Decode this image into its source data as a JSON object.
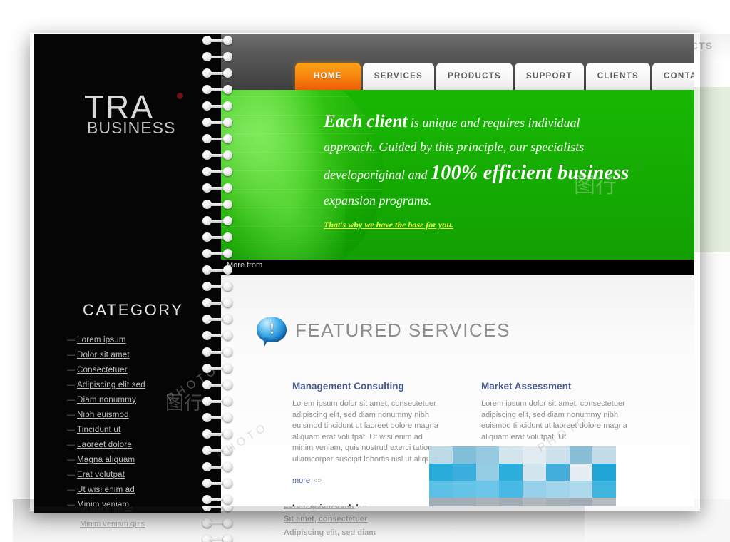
{
  "brand": {
    "logo_main": "TRA",
    "logo_sub": "BUSINESS",
    "accent_orange": "#f78a10",
    "accent_green": "#15ab02",
    "link_blue": "#4a5a8e"
  },
  "nav": {
    "tabs": [
      {
        "label": "HOME",
        "active": true
      },
      {
        "label": "SERVICES",
        "active": false
      },
      {
        "label": "PRODUCTS",
        "active": false
      },
      {
        "label": "SUPPORT",
        "active": false
      },
      {
        "label": "CLIENTS",
        "active": false
      },
      {
        "label": "CONTACTS",
        "active": false
      }
    ]
  },
  "hero": {
    "line1_bold": "Each client",
    "line1_rest": " is unique and requires individual",
    "line2": "approach. Guided by this principle, our specialists",
    "line3_pre": "developoriginal and ",
    "line3_bold": "100% efficient business",
    "line4": "expansion programs.",
    "link": "That's why we have the base for you."
  },
  "strip": {
    "more_from": "More from"
  },
  "sidebar": {
    "heading": "CATEGORY",
    "bullet": "—",
    "items": [
      {
        "label": "Lorem ipsum"
      },
      {
        "label": "Dolor sit amet"
      },
      {
        "label": "Consectetuer"
      },
      {
        "label": "Adipiscing elit sed"
      },
      {
        "label": "Diam nonummy"
      },
      {
        "label": "Nibh euismod"
      },
      {
        "label": "Tincidunt ut"
      },
      {
        "label": "Laoreet dolore"
      },
      {
        "label": "Magna aliquam"
      },
      {
        "label": "Erat volutpat"
      },
      {
        "label": "Ut wisi enim ad"
      },
      {
        "label": "Minim veniam"
      }
    ]
  },
  "featured": {
    "icon": "speech-bubble-exclamation-icon",
    "title": "FEATURED SERVICES",
    "columns": [
      {
        "heading": "Management Consulting",
        "body": "Lorem ipsum dolor sit amet, consectetuer adipiscing elit, sed diam nonummy nibh euismod tincidunt ut laoreet dolore magna aliquam erat volutpat. Ut wisi enim ad minim veniam, quis nostrud exerci tation ullamcorper suscipit lobortis nisl ut aliquip.",
        "more_label": "more",
        "more_chevron": "»»",
        "sub_links": [
          "Lorem ipsum dolor",
          "Sit amet, consectetuer",
          "Adipiscing elit, sed diam"
        ]
      },
      {
        "heading": "Market Assessment",
        "body": "Lorem ipsum dolor sit amet, consectetuer adipiscing elit, sed diam nonummy nibh euismod tincidunt ut laoreet dolore magna aliquam erat volutpat. Ut",
        "more_label": "",
        "more_chevron": "",
        "sub_links": []
      }
    ]
  },
  "background_page": {
    "tab_fragment": "ACTS",
    "sidebar_items": [
      "Ut wisi enim ad",
      "Minim veniam quis"
    ],
    "content_links": [
      "Adipiscing elit, sed diam",
      "Lorem ipsum dolor",
      "Sit amet, consectetuer",
      "Adipiscing elit, sed diam"
    ]
  },
  "watermark": {
    "text": "PHOTOPHOTO",
    "logo": "图行天下"
  },
  "mosaic_colors": [
    "#b7d7e4",
    "#79b9d6",
    "#8ec6de",
    "#cfe3ec",
    "#dfeaf0",
    "#c8dfea",
    "#7db9d2",
    "#bfd9e5",
    "#17a6d8",
    "#2aa9dc",
    "#8dc9e3",
    "#1ba9da",
    "#cfe5ef",
    "#31a8d9",
    "#e2edf3",
    "#0e9ed4",
    "#4ebbe5",
    "#57bfe7",
    "#5fc2e8",
    "#39b4e2",
    "#8fcde9",
    "#9bd2eb",
    "#a7d7ec",
    "#2fb0de",
    "#9aa6ae",
    "#9aa6ae",
    "#a2adb4",
    "#9aa6ae",
    "#a8b3b9",
    "#a0abb2",
    "#9aa6ae",
    "#aab5bb"
  ]
}
